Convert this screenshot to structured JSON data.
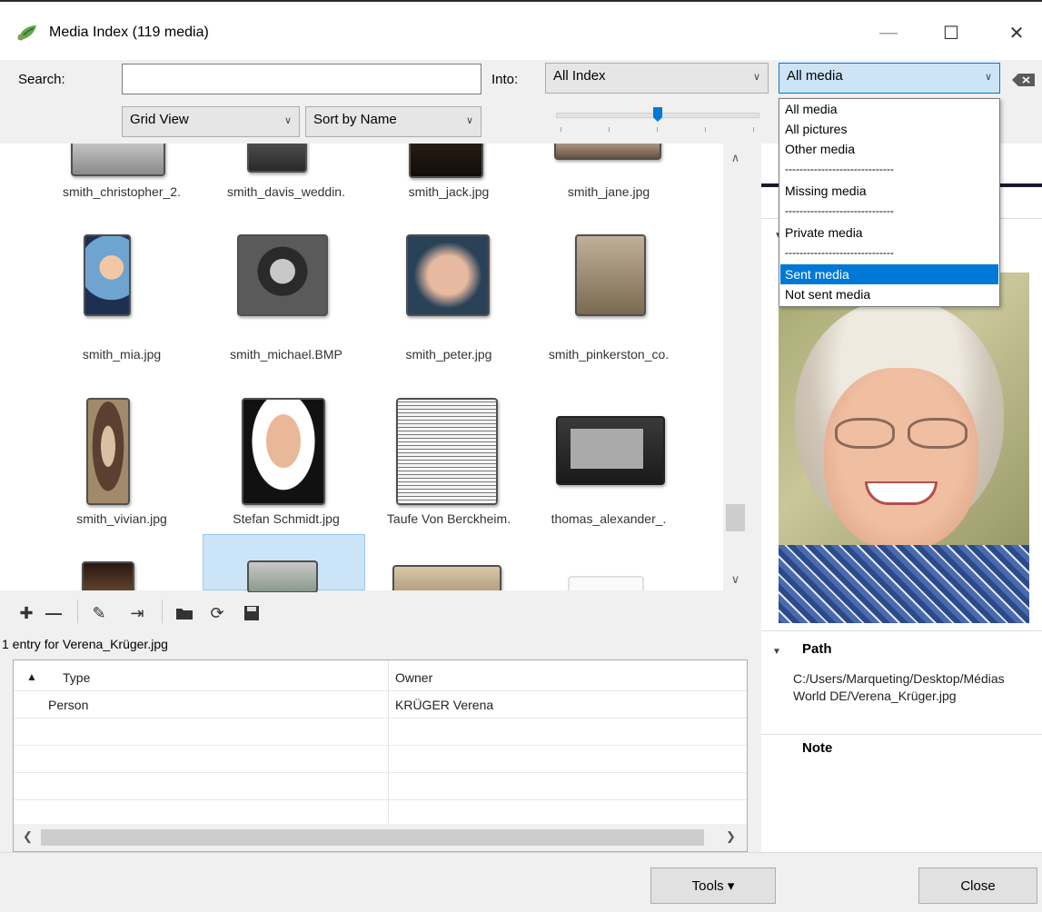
{
  "window": {
    "title": "Media Index (119 media)",
    "minimize": "—",
    "maximize": "☐",
    "close": "✕"
  },
  "toolbar": {
    "search_label": "Search:",
    "search_value": "",
    "into_label": "Into:",
    "into_value": "All Index",
    "filter_value": "All media",
    "view_value": "Grid View",
    "sort_value": "Sort by Name"
  },
  "filter_dropdown": {
    "options": [
      "All media",
      "All pictures",
      "Other media",
      "------------------------------",
      "Missing media",
      "------------------------------",
      "Private media",
      "------------------------------",
      "Sent media",
      "Not sent media"
    ],
    "selected": "Sent media"
  },
  "grid": {
    "row1": [
      "smith_christopher_2.",
      "smith_davis_weddin.",
      "smith_jack.jpg",
      "smith_jane.jpg"
    ],
    "row2": [
      "smith_mia.jpg",
      "smith_michael.BMP",
      "smith_peter.jpg",
      "smith_pinkerston_co."
    ],
    "row3": [
      "smith_vivian.jpg",
      "Stefan Schmidt.jpg",
      "Taufe Von Berckheim.",
      "thomas_alexander_."
    ]
  },
  "entries": {
    "count_label": "1 entry for Verena_Krüger.jpg",
    "col_type": "Type",
    "col_owner": "Owner",
    "rows": [
      {
        "type": "Person",
        "owner": "KRÜGER Verena"
      }
    ]
  },
  "details": {
    "path_title": "Path",
    "path_value": "C:/Users/Marqueting/Desktop/Médias World DE/Verena_Krüger.jpg",
    "note_title": "Note"
  },
  "buttons": {
    "tools": "Tools ▾",
    "close": "Close"
  },
  "colors": {
    "selection": "#0078d7",
    "selected_tile": "#cce4f7"
  }
}
